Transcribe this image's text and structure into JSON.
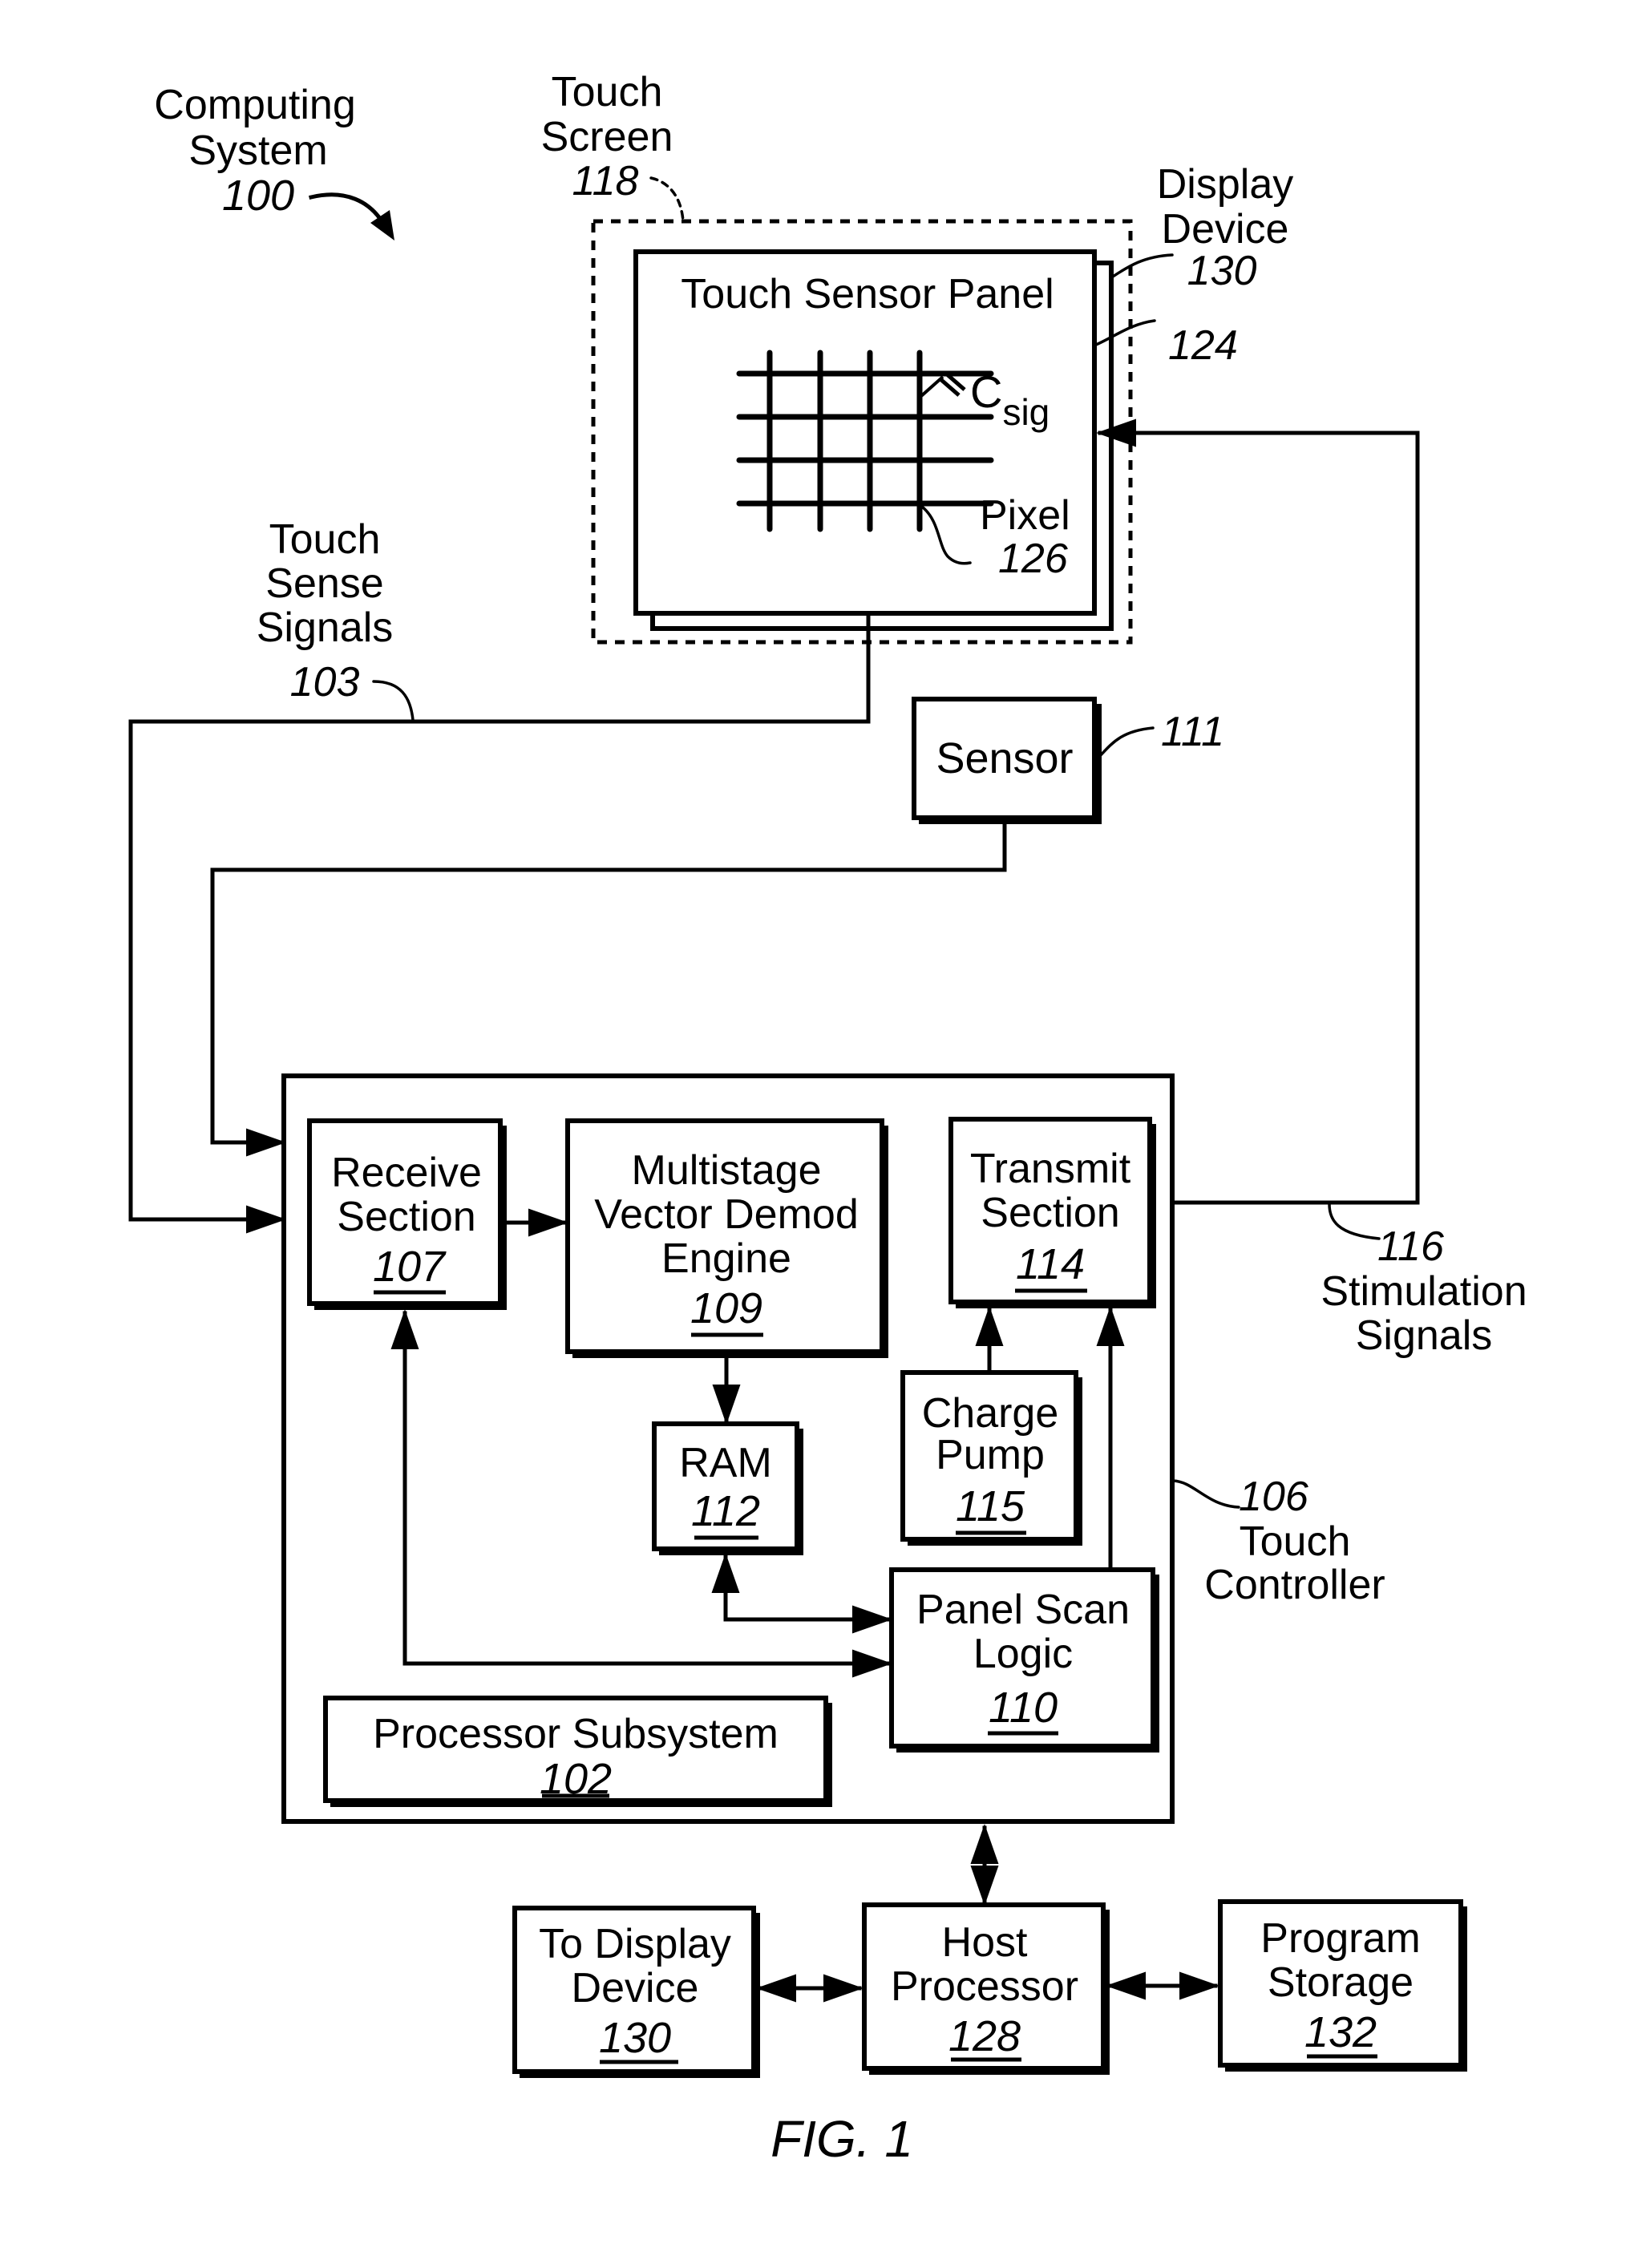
{
  "figure": {
    "caption": "FIG. 1",
    "system_label": [
      "Computing",
      "System"
    ],
    "system_ref": "100"
  },
  "touch_screen": {
    "label": [
      "Touch",
      "Screen"
    ],
    "ref": "118"
  },
  "display_device_callout": {
    "label": [
      "Display",
      "Device"
    ],
    "ref": "130"
  },
  "touch_sensor_panel": {
    "title": "Touch Sensor Panel",
    "ref": "124",
    "csig_main": "C",
    "csig_sub": "sig",
    "pixel_label": "Pixel",
    "pixel_ref": "126"
  },
  "touch_sense_signals": {
    "label": [
      "Touch",
      "Sense",
      "Signals"
    ],
    "ref": "103"
  },
  "sensor": {
    "label": "Sensor",
    "ref": "111"
  },
  "stimulation_signals": {
    "ref": "116",
    "label": [
      "Stimulation",
      "Signals"
    ]
  },
  "touch_controller": {
    "ref": "106",
    "label": [
      "Touch",
      "Controller"
    ]
  },
  "blocks": {
    "receive": {
      "label": [
        "Receive",
        "Section"
      ],
      "ref": "107"
    },
    "demod": {
      "label": [
        "Multistage",
        "Vector Demod",
        "Engine"
      ],
      "ref": "109"
    },
    "transmit": {
      "label": [
        "Transmit",
        "Section"
      ],
      "ref": "114"
    },
    "ram": {
      "label": [
        "RAM"
      ],
      "ref": "112"
    },
    "charge_pump": {
      "label": [
        "Charge",
        "Pump"
      ],
      "ref": "115"
    },
    "panel_scan": {
      "label": [
        "Panel Scan",
        "Logic"
      ],
      "ref": "110"
    },
    "processor_subsystem": {
      "label": [
        "Processor Subsystem"
      ],
      "ref": "102"
    },
    "to_display": {
      "label": [
        "To Display",
        "Device"
      ],
      "ref": "130"
    },
    "host_processor": {
      "label": [
        "Host",
        "Processor"
      ],
      "ref": "128"
    },
    "program_storage": {
      "label": [
        "Program",
        "Storage"
      ],
      "ref": "132"
    }
  }
}
